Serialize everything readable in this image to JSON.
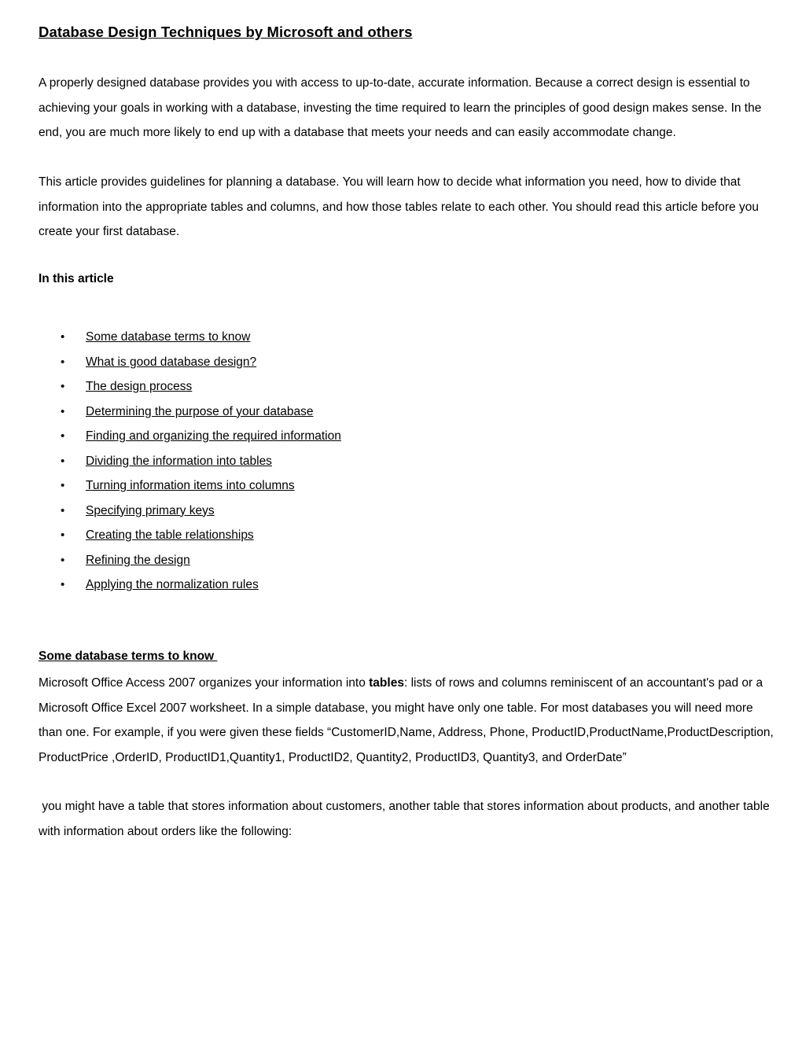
{
  "document": {
    "title": "Database Design Techniques by Microsoft and others",
    "intro_paragraph_1": "A properly designed database provides you with access to up-to-date, accurate information. Because a correct design is essential to achieving your goals in working with a database, investing the time required to learn the principles of good design makes sense. In the end, you are much more likely to end up with a database that meets your needs and can easily accommodate change.",
    "intro_paragraph_2": "This article provides guidelines for planning a database. You will learn how to decide what information you need, how to divide that information into the appropriate tables and columns, and how those tables relate to each other. You should read this article before you create your first database.",
    "in_this_article_heading": "In this article",
    "toc": [
      {
        "bullet": "•",
        "label": "Some database terms to know"
      },
      {
        "bullet": "•",
        "label": "What is good database design?"
      },
      {
        "bullet": "•",
        "label": "The design process"
      },
      {
        "bullet": "•",
        "label": "Determining the purpose of your database"
      },
      {
        "bullet": "•",
        "label": "Finding and organizing the required information"
      },
      {
        "bullet": "•",
        "label": "Dividing the information into tables"
      },
      {
        "bullet": "•",
        "label": "Turning information items into columns"
      },
      {
        "bullet": "•",
        "label": "Specifying primary keys"
      },
      {
        "bullet": "•",
        "label": "Creating the table relationships"
      },
      {
        "bullet": "•",
        "label": "Refining the design"
      },
      {
        "bullet": "•",
        "label": "Applying the normalization rules"
      }
    ],
    "section_terms": {
      "heading": "Some database terms to know ",
      "para_before_bold": "Microsoft Office Access 2007 organizes your information into ",
      "para_bold": "tables",
      "para_after_bold": ": lists of rows and columns reminiscent of an accountant's pad or a Microsoft Office Excel 2007 worksheet. In a simple database, you might have only one table. For most databases you will need more than one. For example, if you were given these fields “CustomerID,Name, Address, Phone, ProductID,ProductName,ProductDescription, ProductPrice ,OrderID, ProductID1,Quantity1, ProductID2, Quantity2, ProductID3, Quantity3, and OrderDate”",
      "para_continuation": " you might have a table that stores information about customers, another table that stores information about products, and another table with information about orders like the following:"
    }
  }
}
